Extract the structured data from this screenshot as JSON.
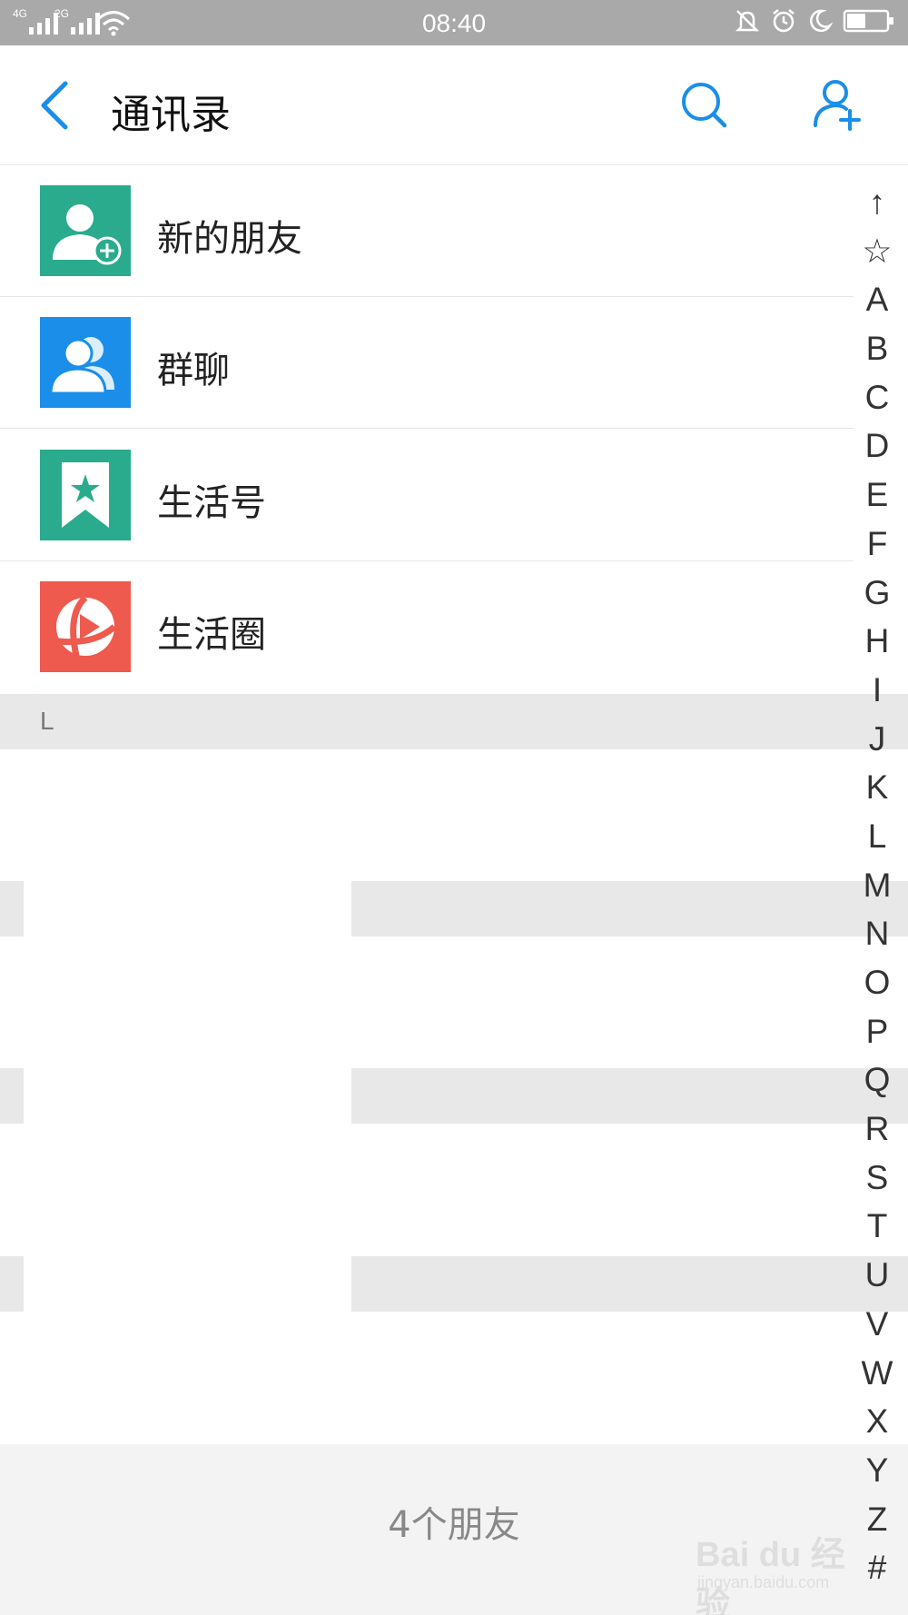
{
  "status_bar": {
    "time": "08:40",
    "signal_1_label": "4G",
    "signal_2_label": "2G",
    "icons": [
      "signal-icon",
      "signal-icon",
      "wifi-icon",
      "mute-icon",
      "alarm-icon",
      "moon-icon",
      "battery-icon"
    ]
  },
  "header": {
    "title": "通讯录",
    "accent_color": "#1a8ee8"
  },
  "function_items": [
    {
      "label": "新的朋友",
      "icon": "new-friend-icon",
      "color": "#2aab8e"
    },
    {
      "label": "群聊",
      "icon": "group-chat-icon",
      "color": "#1a8ee8"
    },
    {
      "label": "生活号",
      "icon": "life-account-icon",
      "color": "#2aab8e"
    },
    {
      "label": "生活圈",
      "icon": "life-circle-icon",
      "color": "#ef5a4e"
    }
  ],
  "section": {
    "letter": "L"
  },
  "index_bar": [
    "↑",
    "☆",
    "A",
    "B",
    "C",
    "D",
    "E",
    "F",
    "G",
    "H",
    "I",
    "J",
    "K",
    "L",
    "M",
    "N",
    "O",
    "P",
    "Q",
    "R",
    "S",
    "T",
    "U",
    "V",
    "W",
    "X",
    "Y",
    "Z",
    "#"
  ],
  "footer": {
    "friend_count": "4个朋友"
  },
  "watermark": {
    "text": "Bai du 经验",
    "url": "jingyan.baidu.com"
  }
}
